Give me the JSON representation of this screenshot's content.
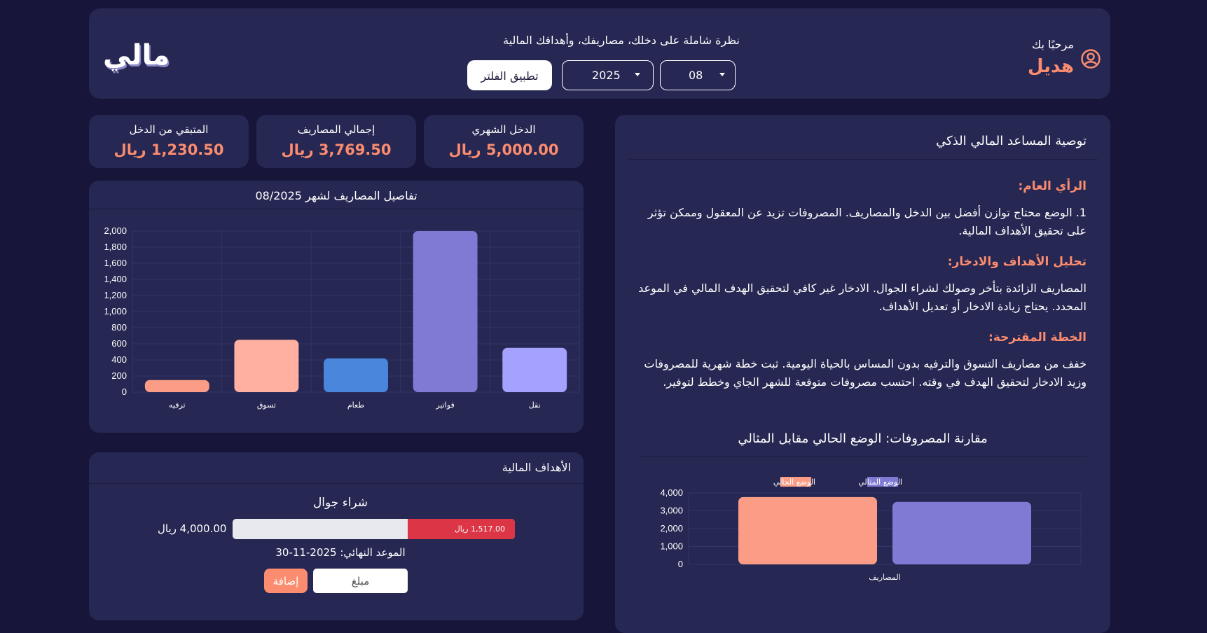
{
  "header": {
    "welcome_text": "مرحبًا بك",
    "user_name": "هديل",
    "tagline": "نظرة شاملة على دخلك، مصاريفك، وأهدافك المالية",
    "month_value": "08",
    "year_value": "2025",
    "filter_label": "تطبيق الفلتر",
    "logo_text": "مالي"
  },
  "stats": [
    {
      "label": "الدخل الشهري",
      "value": "5,000.00 ريال"
    },
    {
      "label": "إجمالي المصاريف",
      "value": "3,769.50 ريال"
    },
    {
      "label": "المتبقي من الدخل",
      "value": "1,230.50 ريال"
    }
  ],
  "expense_chart": {
    "title": "تفاصيل المصاريف لشهر 08/2025"
  },
  "goals": {
    "title": "الأهداف المالية",
    "goal_name": "شراء جوال",
    "target": "4,000.00 ريال",
    "saved_label": "1,517.00 ريال",
    "progress_fraction": 0.38,
    "deadline": "الموعد النهائي: 2025-11-30",
    "amount_placeholder": "مبلغ",
    "add_label": "إضافة"
  },
  "advisor": {
    "title": "توصية المساعد المالي الذكي",
    "section1_heading": "الرأي العام:",
    "section1_text": "1. الوضع محتاج توازن أفضل بين الدخل والمصاريف. المصروفات تزيد عن المعقول وممكن تؤثر على تحقيق الأهداف المالية.",
    "section2_heading": "تحليل الأهداف والادخار:",
    "section2_text": "المصاريف الزائدة بتأخر وصولك لشراء الجوال. الادخار غير كافي لتحقيق الهدف المالي في الموعد المحدد. يحتاج زيادة الادخار أو تعديل الأهداف.",
    "section3_heading": "الخطة المقترحة:",
    "section3_text": "خفف من مصاريف التسوق والترفيه بدون المساس بالحياة اليومية. ثبت خطة شهرية للمصروفات وزيد الادخار لتحقيق الهدف في وقته. احتسب مصروفات متوقعة للشهر الجاي وخطط لتوفير.",
    "compare_title": "مقارنة المصروفات: الوضع الحالي مقابل المثالي"
  },
  "colors": {
    "background": "#17153a",
    "card": "#262752",
    "accent": "#fb8c6f",
    "danger": "#dc3545"
  },
  "icons": {
    "user": "user-circle-icon",
    "caret": "chevron-down-icon"
  },
  "chart_data": [
    {
      "type": "bar",
      "title": "تفاصيل المصاريف لشهر 08/2025",
      "categories": [
        "ترفيه",
        "تسوق",
        "طعام",
        "فواتير",
        "نقل"
      ],
      "values": [
        150,
        650,
        420,
        2000,
        550
      ],
      "colors": [
        "#fb9d86",
        "#ffb0a0",
        "#4a86dc",
        "#7f7bd4",
        "#a5a2ff"
      ],
      "ylim": [
        0,
        2000
      ],
      "yticks": [
        0,
        200,
        400,
        600,
        800,
        1000,
        1200,
        1400,
        1600,
        1800,
        2000
      ],
      "grid": true
    },
    {
      "type": "bar",
      "categories": [
        "المصاريف"
      ],
      "series": [
        {
          "name": "الوضع الحالي",
          "values": [
            3769.5
          ],
          "color": "#fb9d86"
        },
        {
          "name": "الوضع المثالي",
          "values": [
            3500
          ],
          "color": "#7f7bd4"
        }
      ],
      "ylim": [
        0,
        4000
      ],
      "yticks": [
        0,
        1000,
        2000,
        3000,
        4000
      ],
      "legend": "top-center",
      "grid": true
    }
  ]
}
